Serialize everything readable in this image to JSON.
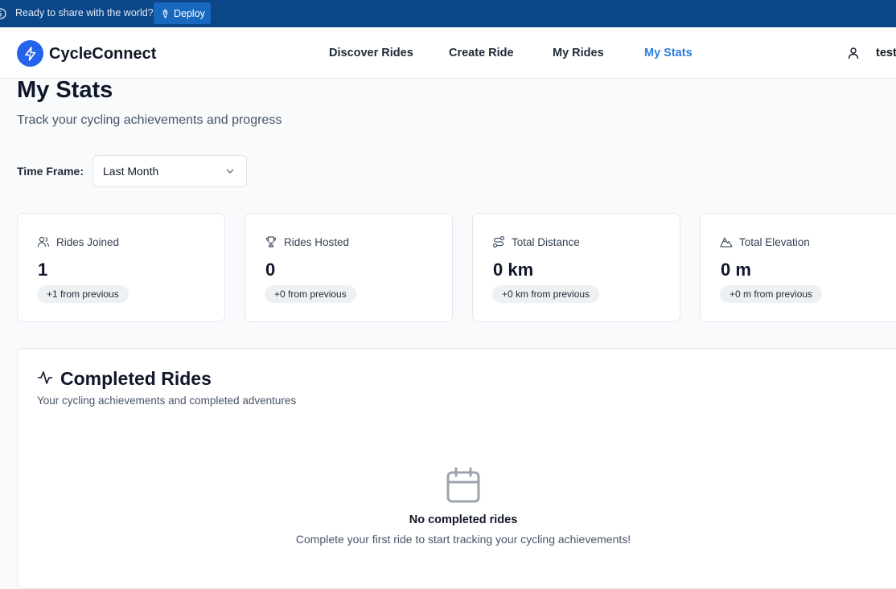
{
  "banner": {
    "text": "Ready to share with the world?",
    "deploy_label": "Deploy"
  },
  "navbar": {
    "brand": "CycleConnect",
    "links": [
      {
        "label": "Discover Rides",
        "active": false
      },
      {
        "label": "Create Ride",
        "active": false
      },
      {
        "label": "My Rides",
        "active": false
      },
      {
        "label": "My Stats",
        "active": true
      }
    ],
    "user_name": "test"
  },
  "page": {
    "title": "My Stats",
    "subtitle": "Track your cycling achievements and progress"
  },
  "timeframe": {
    "label": "Time Frame:",
    "selected": "Last Month"
  },
  "stats": [
    {
      "icon": "users-icon",
      "label": "Rides Joined",
      "value": "1",
      "change": "+1 from previous"
    },
    {
      "icon": "trophy-icon",
      "label": "Rides Hosted",
      "value": "0",
      "change": "+0 from previous"
    },
    {
      "icon": "route-icon",
      "label": "Total Distance",
      "value": "0 km",
      "change": "+0 km from previous"
    },
    {
      "icon": "mountain-icon",
      "label": "Total Elevation",
      "value": "0 m",
      "change": "+0 m from previous"
    }
  ],
  "completed": {
    "title": "Completed Rides",
    "subtitle": "Your cycling achievements and completed adventures",
    "empty_title": "No completed rides",
    "empty_subtitle": "Complete your first ride to start tracking your cycling achievements!"
  },
  "colors": {
    "banner_bg": "#0b4688",
    "accent": "#2563eb",
    "active_link": "#2b7de0"
  }
}
